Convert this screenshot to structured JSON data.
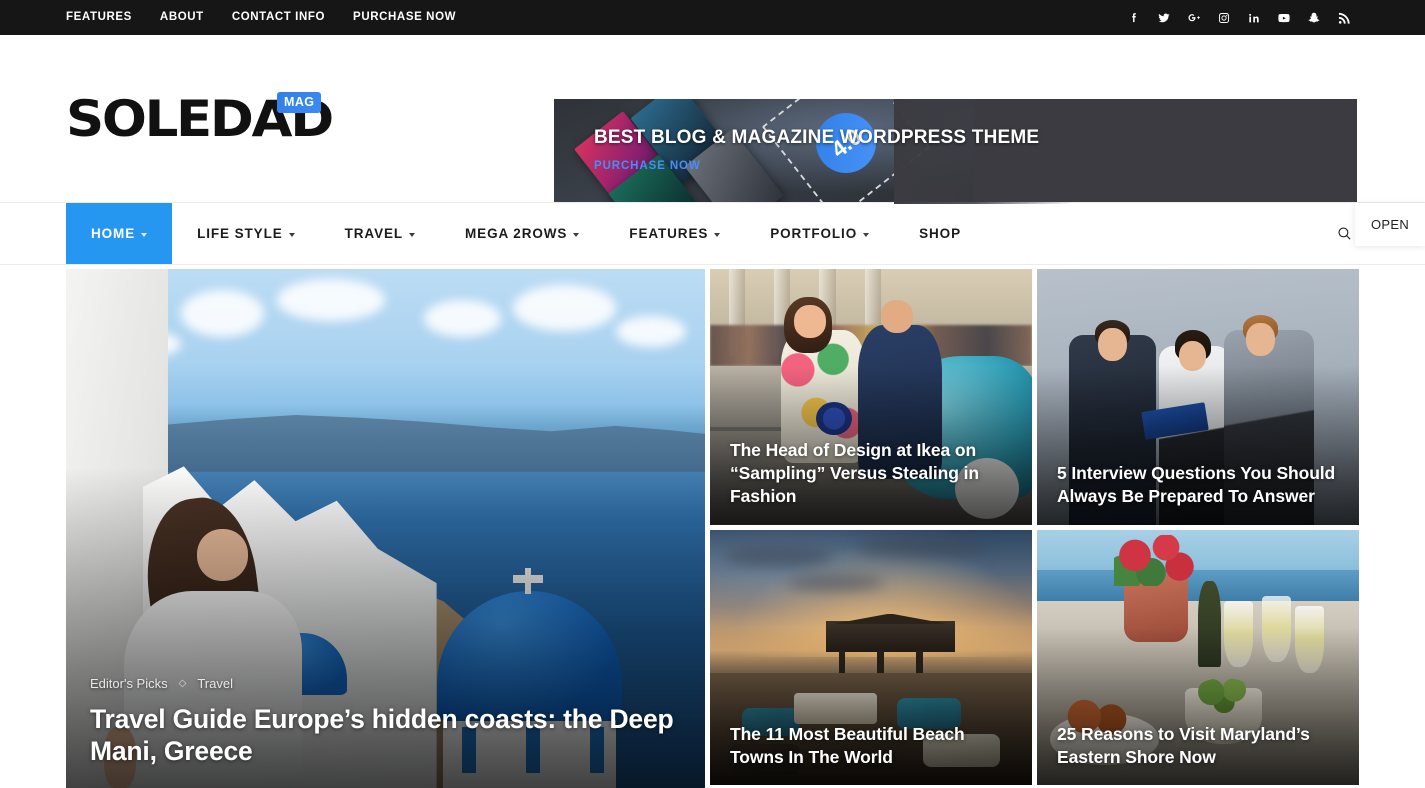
{
  "topbar": {
    "links": [
      {
        "label": "FEATURES"
      },
      {
        "label": "ABOUT"
      },
      {
        "label": "CONTACT INFO"
      },
      {
        "label": "PURCHASE NOW"
      }
    ],
    "social": [
      {
        "name": "facebook"
      },
      {
        "name": "twitter"
      },
      {
        "name": "google-plus"
      },
      {
        "name": "instagram"
      },
      {
        "name": "linkedin"
      },
      {
        "name": "youtube"
      },
      {
        "name": "snapchat"
      },
      {
        "name": "rss"
      }
    ],
    "background": "#161616"
  },
  "header": {
    "logo_text": "SOLEDAD",
    "logo_badge": "MAG",
    "badge_color": "#3d8bf2"
  },
  "banner": {
    "title": "BEST BLOG & MAGAZINE WORDPRESS THEME",
    "cta": "PURCHASE NOW",
    "cta_color": "#4a8df5",
    "version_badge": "4.0",
    "background": "#3b3b41"
  },
  "open_tooltip": {
    "label": "OPEN"
  },
  "nav": {
    "active_color": "#2697f0",
    "items": [
      {
        "label": "HOME",
        "has_dropdown": true,
        "active": true
      },
      {
        "label": "LIFE STYLE",
        "has_dropdown": true,
        "active": false
      },
      {
        "label": "TRAVEL",
        "has_dropdown": true,
        "active": false
      },
      {
        "label": "MEGA 2ROWS",
        "has_dropdown": true,
        "active": false
      },
      {
        "label": "FEATURES",
        "has_dropdown": true,
        "active": false
      },
      {
        "label": "PORTFOLIO",
        "has_dropdown": true,
        "active": false
      },
      {
        "label": "SHOP",
        "has_dropdown": false,
        "active": false
      }
    ],
    "search_icon": "search-icon"
  },
  "hero": {
    "featured": {
      "categories": [
        "Editor's Picks",
        "Travel"
      ],
      "separator": "◇",
      "title": "Travel Guide Europe’s hidden coasts: the Deep Mani, Greece"
    },
    "cells": [
      {
        "title": "The Head of Design at Ikea on “Sampling” Versus Stealing in Fashion"
      },
      {
        "title": "5 Interview Questions You Should Always Be Prepared To Answer"
      },
      {
        "title": "The 11 Most Beautiful Beach Towns In The World"
      },
      {
        "title": "25 Reasons to Visit Maryland’s Eastern Shore Now"
      }
    ]
  }
}
